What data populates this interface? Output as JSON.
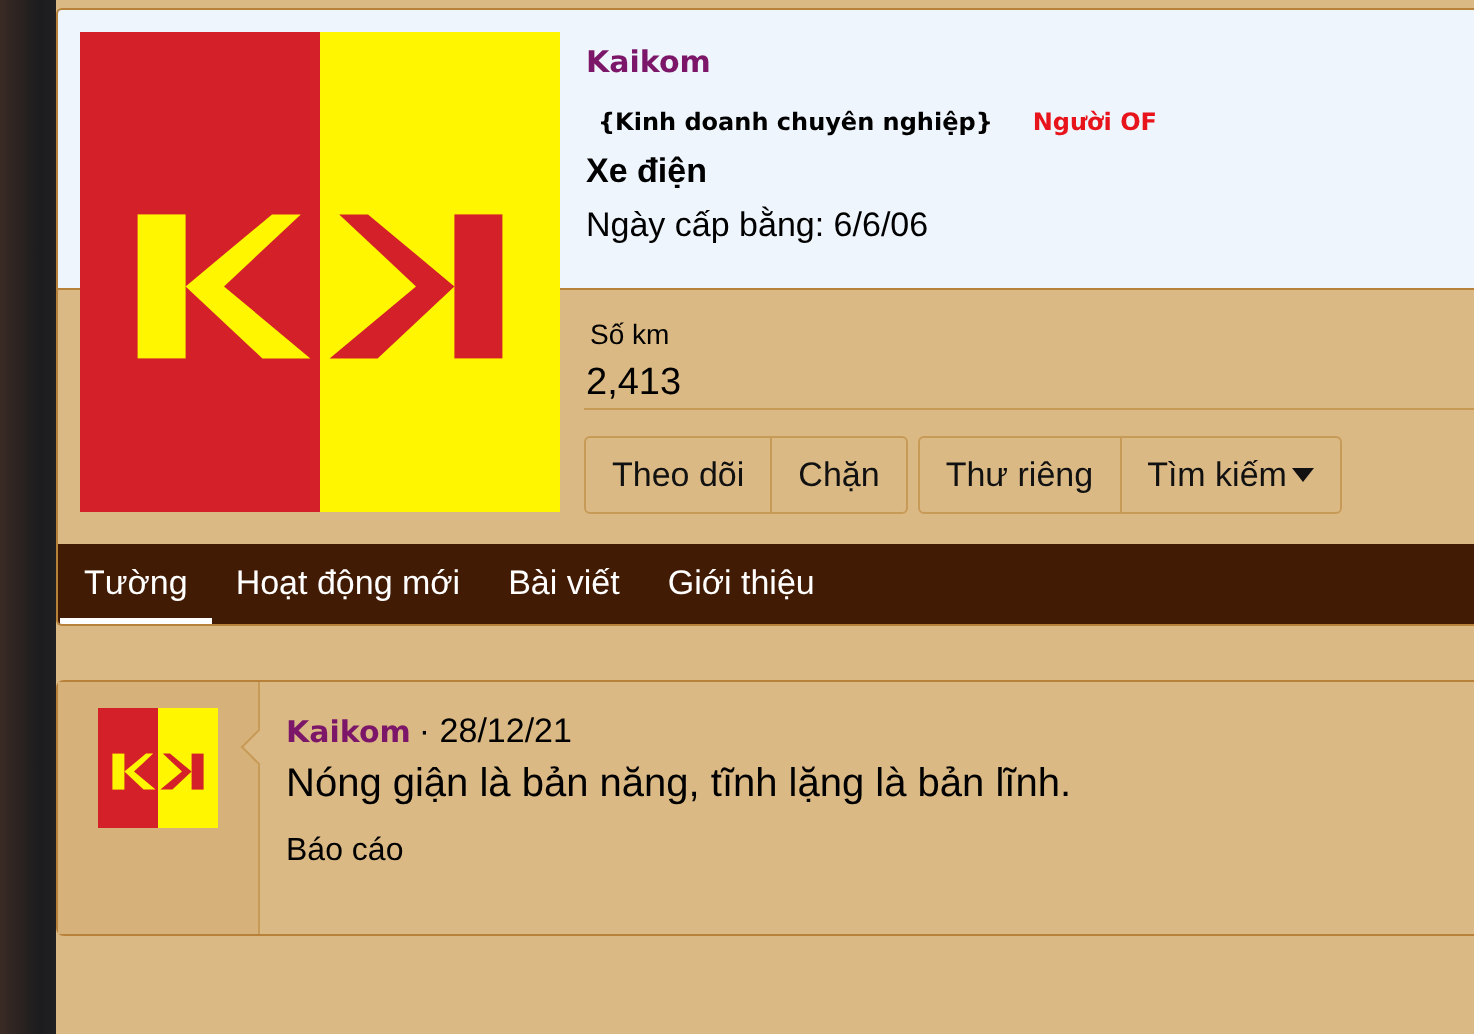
{
  "profile": {
    "username": "Kaikom",
    "title": "{Kinh doanh chuyên nghiệp}",
    "badge": "Người OF",
    "vehicle": "Xe điện",
    "license_date": "Ngày cấp bằng: 6/6/06",
    "stat": {
      "label": "Số km",
      "value": "2,413"
    },
    "button_groups": [
      [
        {
          "label": "Theo dõi",
          "caret": false
        },
        {
          "label": "Chặn",
          "caret": false
        }
      ],
      [
        {
          "label": "Thư riêng",
          "caret": false
        },
        {
          "label": "Tìm kiếm",
          "caret": true
        }
      ]
    ],
    "tabs": [
      {
        "label": "Tường",
        "selected": true
      },
      {
        "label": "Hoạt động mới",
        "selected": false
      },
      {
        "label": "Bài viết",
        "selected": false
      },
      {
        "label": "Giới thiệu",
        "selected": false
      }
    ]
  },
  "post": {
    "author": "Kaikom",
    "date": "· 28/12/21",
    "text": "Nóng giận là bản năng, tĩnh lặng là bản lĩnh.",
    "report": "Báo cáo"
  }
}
